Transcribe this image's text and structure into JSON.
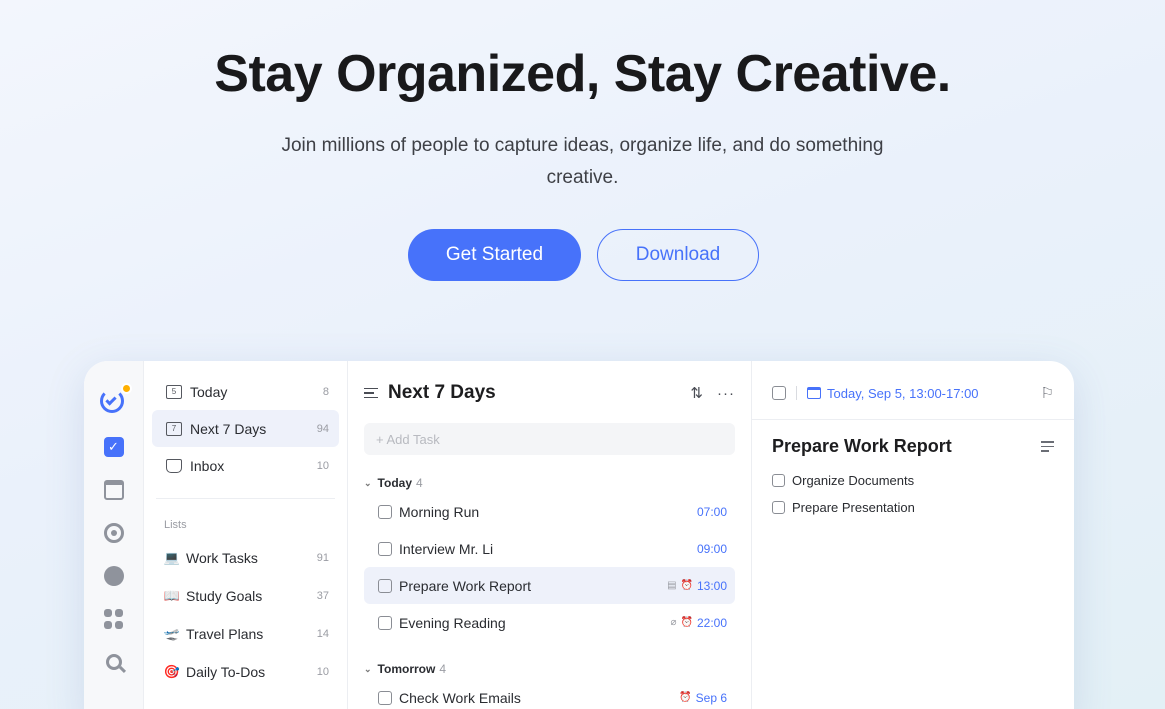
{
  "hero": {
    "title": "Stay Organized, Stay Creative.",
    "subtitle": "Join millions of people to capture ideas, organize life, and do something creative.",
    "primary_cta": "Get Started",
    "secondary_cta": "Download"
  },
  "colors": {
    "accent": "#4772fa",
    "badge": "#ffb000"
  },
  "rail": {
    "icons": [
      "logo-icon",
      "tasks-checkbox-icon",
      "calendar-icon",
      "focus-icon",
      "habit-clock-icon",
      "matrix-grid-icon",
      "search-icon"
    ]
  },
  "sidebar": {
    "nav": [
      {
        "label": "Today",
        "count": "8",
        "icon_text": "5"
      },
      {
        "label": "Next 7 Days",
        "count": "94",
        "icon_text": "7"
      },
      {
        "label": "Inbox",
        "count": "10",
        "icon_text": ""
      }
    ],
    "lists_label": "Lists",
    "lists": [
      {
        "emoji": "💻",
        "label": "Work Tasks",
        "count": "91"
      },
      {
        "emoji": "📖",
        "label": "Study Goals",
        "count": "37"
      },
      {
        "emoji": "🛫",
        "label": "Travel Plans",
        "count": "14"
      },
      {
        "emoji": "🎯",
        "label": "Daily To-Dos",
        "count": "10"
      }
    ]
  },
  "tasks": {
    "title": "Next 7 Days",
    "add_placeholder": "+ Add Task",
    "groups": [
      {
        "name": "Today",
        "count": "4",
        "items": [
          {
            "label": "Morning Run",
            "time": "07:00"
          },
          {
            "label": "Interview Mr. Li",
            "time": "09:00"
          },
          {
            "label": "Prepare Work Report",
            "time": "13:00"
          },
          {
            "label": "Evening Reading",
            "time": "22:00"
          }
        ]
      },
      {
        "name": "Tomorrow",
        "count": "4",
        "items": [
          {
            "label": "Check Work Emails",
            "time": "Sep 6"
          }
        ]
      }
    ]
  },
  "detail": {
    "date": "Today, Sep 5, 13:00-17:00",
    "title": "Prepare Work Report",
    "subtasks": [
      "Organize Documents",
      "Prepare Presentation"
    ]
  }
}
